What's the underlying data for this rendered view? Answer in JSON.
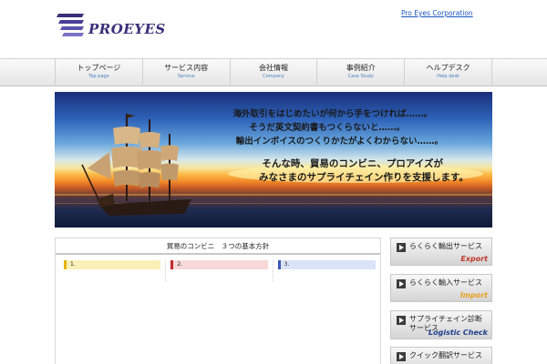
{
  "header": {
    "logo_text": "PROEYES",
    "logo_subtitle": "",
    "tagline": "",
    "corp_link": " Pro Eyes Corporation"
  },
  "nav": [
    {
      "jp": "トップページ",
      "en": "Top page"
    },
    {
      "jp": "サービス内容",
      "en": "Service"
    },
    {
      "jp": "会社情報",
      "en": "Company"
    },
    {
      "jp": "事例紹介",
      "en": "Case Study"
    },
    {
      "jp": "ヘルプデスク",
      "en": "Help desk"
    }
  ],
  "hero": {
    "line1": "海外取引をはじめたいが何から手をつければ……。",
    "line2": "そうだ英文契約書もつくらないと……。",
    "line3": "輸出インボイスのつくりかたがよくわからない……。",
    "line4": "そんな時、貿易のコンビニ、プロアイズが",
    "line5": "みなさまのサプライチェイン作りを支援します。"
  },
  "policy": {
    "title": "貿易のコンビニ　３つの基本方針",
    "columns": [
      {
        "heading": "1.",
        "paragraphs": [
          "",
          "",
          ""
        ]
      },
      {
        "heading": "2.",
        "paragraphs": [
          "",
          "",
          ""
        ]
      },
      {
        "heading": "3.",
        "paragraphs": [
          "",
          ""
        ]
      }
    ]
  },
  "side": [
    {
      "label": "らくらく輸出サービス",
      "en": "Export",
      "color": "#c0392b"
    },
    {
      "label": "らくらく輸入サービス",
      "en": "Import",
      "color": "#e8a020"
    },
    {
      "label": "サプライチェイン診断サービス",
      "en": "Logistic Check",
      "color": "#1d3f8c"
    },
    {
      "label": "クイック翻訳サービス",
      "en": "",
      "color": "#333333"
    }
  ],
  "colors": {
    "link": "#1a55c0",
    "nav_en": "#4a7fc0",
    "logo": "#3a2f7a"
  }
}
